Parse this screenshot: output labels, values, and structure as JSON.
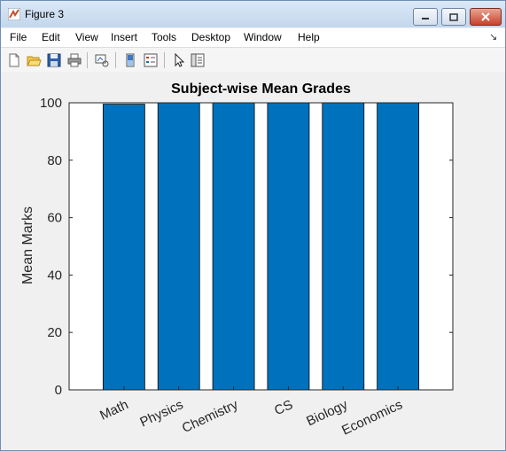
{
  "window": {
    "title": "Figure 3",
    "icon": "matlab-figure-icon",
    "controls": [
      "minimize",
      "maximize",
      "close"
    ]
  },
  "menu": [
    "File",
    "Edit",
    "View",
    "Insert",
    "Tools",
    "Desktop",
    "Window",
    "Help"
  ],
  "toolbar": [
    "new-figure-icon",
    "open-file-icon",
    "save-icon",
    "print-icon",
    "link-plot-icon",
    "insert-colorbar-icon",
    "insert-legend-icon",
    "edit-plot-icon",
    "property-inspector-icon"
  ],
  "colors": {
    "bar": "#0072bd",
    "axes_bg": "#ffffff",
    "figure_bg": "#f0f0f0"
  },
  "chart_data": {
    "type": "bar",
    "title": "Subject-wise Mean Grades",
    "xlabel": "",
    "ylabel": "Mean Marks",
    "categories": [
      "Math",
      "Physics",
      "Chemistry",
      "CS",
      "Biology",
      "Economics"
    ],
    "values": [
      99.5,
      100,
      100,
      100,
      100,
      100
    ],
    "ylim": [
      0,
      100
    ],
    "yticks": [
      0,
      20,
      40,
      60,
      80,
      100
    ],
    "grid": false,
    "legend": "none"
  }
}
